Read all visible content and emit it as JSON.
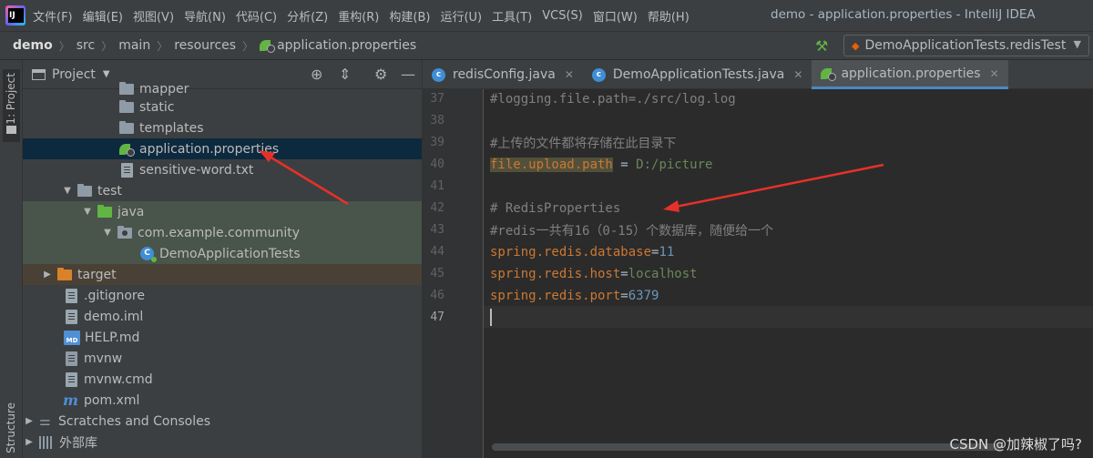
{
  "menubar": {
    "items": [
      "文件(F)",
      "编辑(E)",
      "视图(V)",
      "导航(N)",
      "代码(C)",
      "分析(Z)",
      "重构(R)",
      "构建(B)",
      "运行(U)",
      "工具(T)",
      "VCS(S)",
      "窗口(W)",
      "帮助(H)"
    ],
    "window_title": "demo - application.properties - IntelliJ IDEA"
  },
  "navbar": {
    "crumbs": [
      "demo",
      "src",
      "main",
      "resources",
      "application.properties"
    ],
    "run_config": "DemoApplicationTests.redisTest"
  },
  "left_strip": {
    "project_tab": "1: Project",
    "structure_tab": "Structure"
  },
  "project": {
    "title": "Project",
    "tree": {
      "mapper": "mapper",
      "static": "static",
      "templates": "templates",
      "app_props": "application.properties",
      "sensitive": "sensitive-word.txt",
      "test": "test",
      "java": "java",
      "pkg": "com.example.community",
      "tests_class": "DemoApplicationTests",
      "target": "target",
      "gitignore": ".gitignore",
      "iml": "demo.iml",
      "help": "HELP.md",
      "mvnw": "mvnw",
      "mvnw_cmd": "mvnw.cmd",
      "pom": "pom.xml",
      "scratches": "Scratches and Consoles",
      "ext_libs": "外部库"
    }
  },
  "tabs": [
    {
      "label": "redisConfig.java",
      "icon": "c"
    },
    {
      "label": "DemoApplicationTests.java",
      "icon": "c"
    },
    {
      "label": "application.properties",
      "icon": "spring"
    }
  ],
  "editor": {
    "line_numbers": [
      "37",
      "38",
      "39",
      "40",
      "41",
      "42",
      "43",
      "44",
      "45",
      "46",
      "47"
    ],
    "l37": "#logging.file.path=./src/log.log",
    "l39": "#上传的文件都将存储在此目录下",
    "l40_key": "file.upload.path",
    "l40_eq": " = ",
    "l40_val": "D:/picture",
    "l42": "# RedisProperties",
    "l43": "#redis一共有16（0-15）个数据库，随便给一个",
    "l44_key": "spring.redis.database",
    "l44_val": "11",
    "l45_key": "spring.redis.host",
    "l45_val": "localhost",
    "l46_key": "spring.redis.port",
    "l46_val": "6379",
    "eq": "="
  },
  "watermark": "CSDN @加辣椒了吗?",
  "colors": {
    "annotation_arrow": "#e8302a",
    "accent": "#4a88c7"
  }
}
